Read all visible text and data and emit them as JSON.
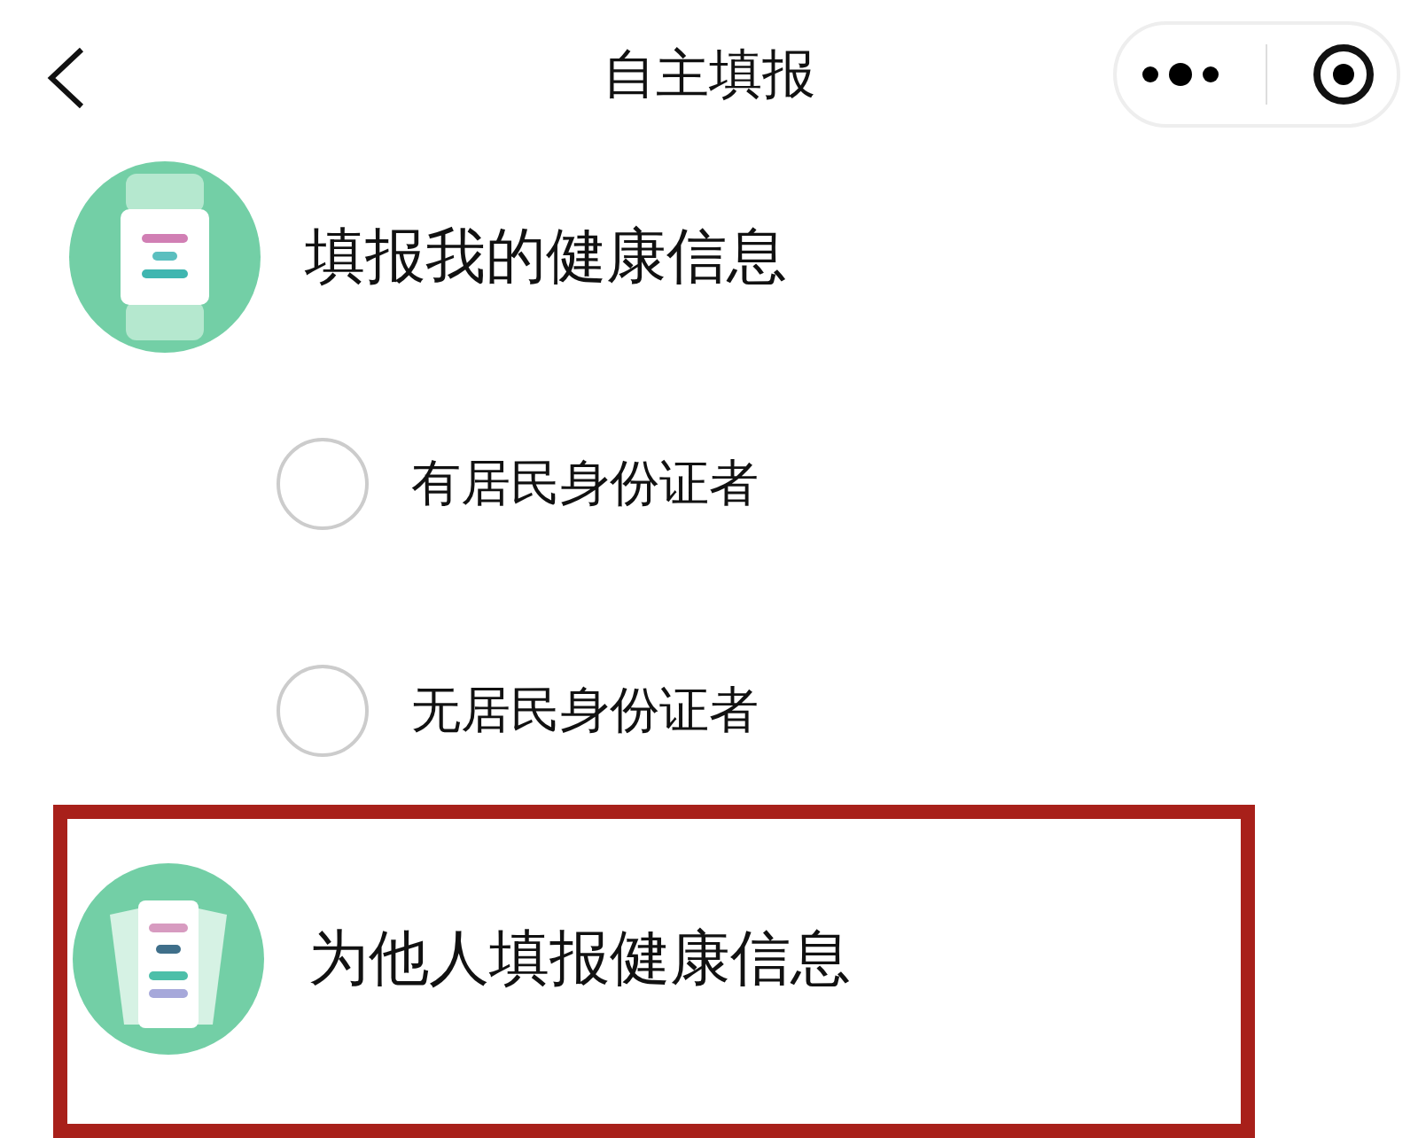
{
  "header": {
    "title": "自主填报"
  },
  "sections": [
    {
      "kind": "self",
      "title": "填报我的健康信息",
      "highlighted": false,
      "options": [
        {
          "label": "有居民身份证者",
          "selected": false
        },
        {
          "label": "无居民身份证者",
          "selected": false
        }
      ]
    },
    {
      "kind": "other",
      "title": "为他人填报健康信息",
      "highlighted": true
    }
  ]
}
